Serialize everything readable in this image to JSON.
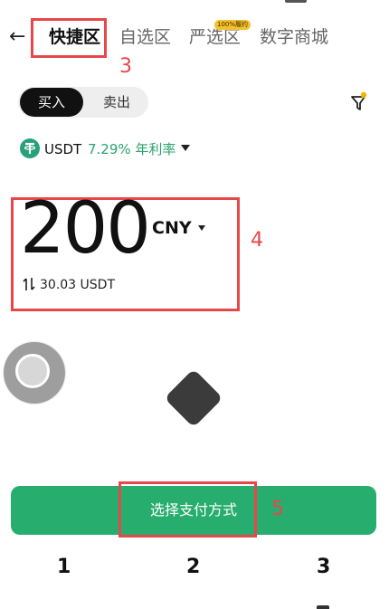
{
  "nav": {
    "back_icon": "arrow-left-icon",
    "tabs": [
      {
        "label": "快捷区",
        "active": true
      },
      {
        "label": "自选区",
        "active": false
      },
      {
        "label": "严选区",
        "active": false,
        "badge": "100%履约"
      },
      {
        "label": "数字商城",
        "active": false
      }
    ]
  },
  "annotations": {
    "box3": "3",
    "box4": "4",
    "box5": "5"
  },
  "toggle": {
    "buy_label": "买入",
    "sell_label": "卖出"
  },
  "filter": {
    "icon": "filter-icon",
    "dot_color": "#f4b400"
  },
  "coin": {
    "name": "USDT",
    "rate": "7.29% 年利率",
    "icon": "tether-icon"
  },
  "amount": {
    "value": "200",
    "currency": "CNY",
    "converted": "30.03 USDT"
  },
  "action": {
    "label": "选择支付方式"
  },
  "bottom_labels": [
    "1",
    "2",
    "3"
  ],
  "colors": {
    "accent_green": "#27ae6e",
    "rate_green": "#2ba36e",
    "annotation_red": "#e8474a"
  }
}
